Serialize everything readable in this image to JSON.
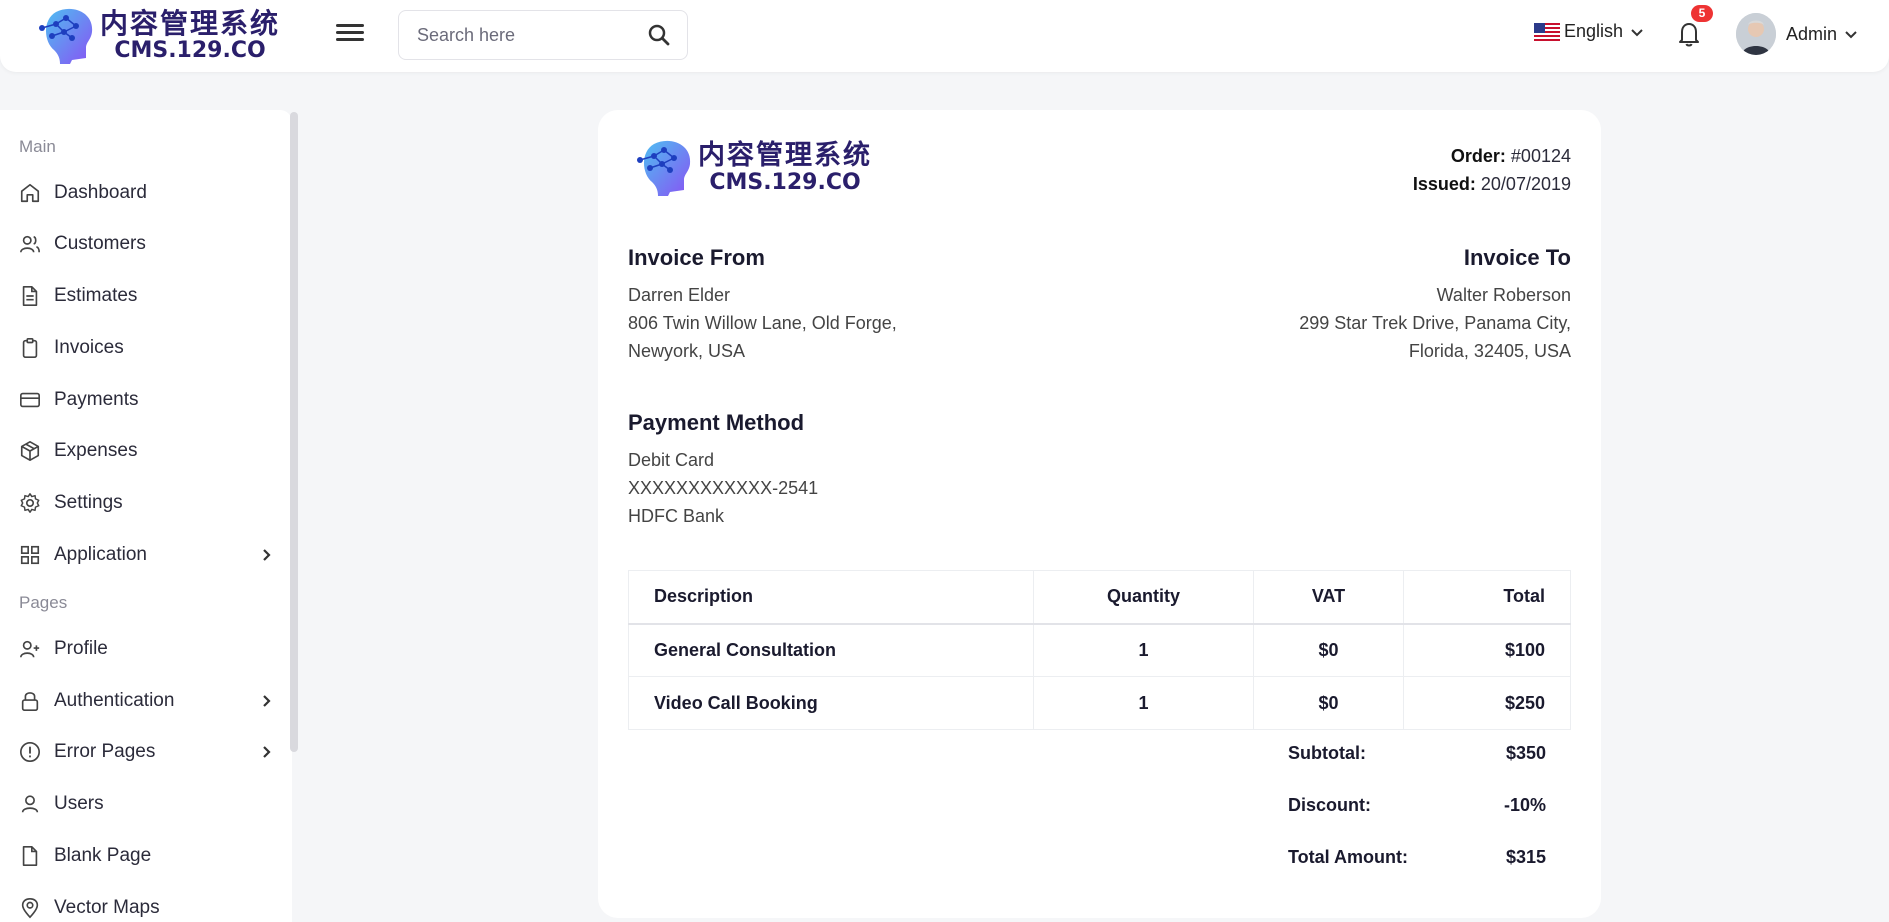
{
  "header": {
    "logo_cn": "内容管理系统",
    "logo_en": "CMS.129.CO",
    "search_placeholder": "Search here",
    "language": "English",
    "notification_count": "5",
    "user_name": "Admin"
  },
  "sidebar": {
    "section_main": "Main",
    "section_pages": "Pages",
    "items": [
      {
        "label": "Dashboard",
        "icon": "home-icon"
      },
      {
        "label": "Customers",
        "icon": "users-icon"
      },
      {
        "label": "Estimates",
        "icon": "file-text-icon"
      },
      {
        "label": "Invoices",
        "icon": "clipboard-icon"
      },
      {
        "label": "Payments",
        "icon": "credit-card-icon"
      },
      {
        "label": "Expenses",
        "icon": "package-icon"
      },
      {
        "label": "Settings",
        "icon": "gear-icon"
      },
      {
        "label": "Application",
        "icon": "grid-icon"
      },
      {
        "label": "Profile",
        "icon": "user-plus-icon"
      },
      {
        "label": "Authentication",
        "icon": "lock-icon"
      },
      {
        "label": "Error Pages",
        "icon": "alert-circle-icon"
      },
      {
        "label": "Users",
        "icon": "user-icon"
      },
      {
        "label": "Blank Page",
        "icon": "file-icon"
      },
      {
        "label": "Vector Maps",
        "icon": "map-pin-icon"
      }
    ]
  },
  "invoice": {
    "logo_cn": "内容管理系统",
    "logo_en": "CMS.129.CO",
    "order_label": "Order:",
    "order_value": "#00124",
    "issued_label": "Issued:",
    "issued_value": "20/07/2019",
    "from_title": "Invoice From",
    "from_lines": [
      "Darren Elder",
      "806 Twin Willow Lane, Old Forge,",
      "Newyork, USA"
    ],
    "to_title": "Invoice To",
    "to_lines": [
      "Walter Roberson",
      "299 Star Trek Drive, Panama City,",
      "Florida, 32405, USA"
    ],
    "payment_title": "Payment Method",
    "payment_lines": [
      "Debit Card",
      "XXXXXXXXXXXX-2541",
      "HDFC Bank"
    ],
    "table": {
      "headers": [
        "Description",
        "Quantity",
        "VAT",
        "Total"
      ],
      "rows": [
        [
          "General Consultation",
          "1",
          "$0",
          "$100"
        ],
        [
          "Video Call Booking",
          "1",
          "$0",
          "$250"
        ]
      ]
    },
    "totals": [
      {
        "label": "Subtotal:",
        "value": "$350"
      },
      {
        "label": "Discount:",
        "value": "-10%"
      },
      {
        "label": "Total Amount:",
        "value": "$315"
      }
    ]
  }
}
